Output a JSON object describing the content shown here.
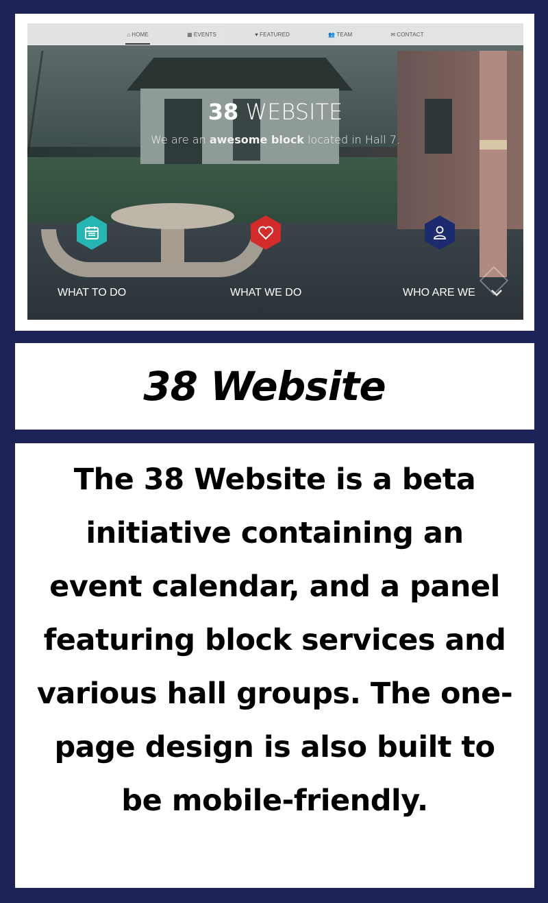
{
  "nav": {
    "items": [
      {
        "label": "HOME",
        "icon": "home-icon",
        "active": true
      },
      {
        "label": "EVENTS",
        "icon": "calendar-icon",
        "active": false
      },
      {
        "label": "FEATURED",
        "icon": "heart-icon",
        "active": false
      },
      {
        "label": "TEAM",
        "icon": "users-icon",
        "active": false
      },
      {
        "label": "CONTACT",
        "icon": "envelope-icon",
        "active": false
      }
    ]
  },
  "hero": {
    "title_bold": "38",
    "title_light": " WEBSITE",
    "subtitle_pre": "We are an ",
    "subtitle_bold": "awesome block",
    "subtitle_post": " located in Hall 7."
  },
  "features": [
    {
      "label": "WHAT TO DO",
      "icon": "calendar-icon",
      "color": "#27b5b1"
    },
    {
      "label": "WHAT WE DO",
      "icon": "heart-icon",
      "color": "#d32a2a"
    },
    {
      "label": "WHO ARE WE",
      "icon": "user-icon",
      "color": "#1c2a6e"
    }
  ],
  "page": {
    "title": "38 Website",
    "description": "The 38 Website is a beta initiative containing an event calendar, and a panel featuring block services and various hall groups. The one-page design is also built to be mobile-friendly."
  },
  "colors": {
    "background": "#1d2356",
    "panel": "#ffffff"
  }
}
